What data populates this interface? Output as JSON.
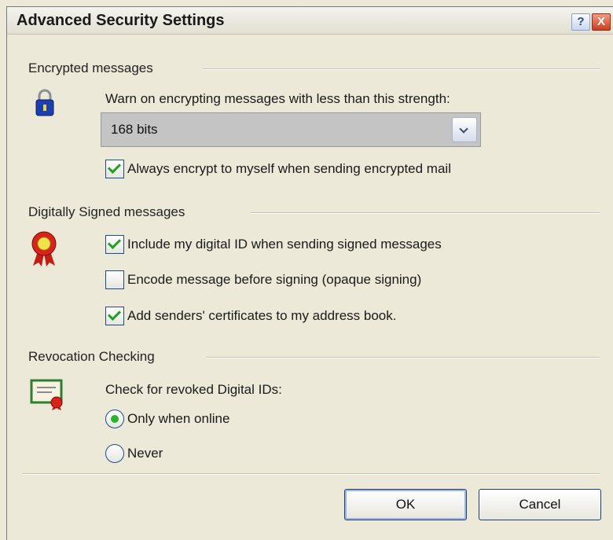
{
  "window": {
    "title": "Advanced Security Settings",
    "help_label": "?",
    "close_label": "X"
  },
  "encrypted": {
    "group_label": "Encrypted messages",
    "icon": "padlock-icon",
    "warn_label": "Warn on encrypting messages with less than this strength:",
    "strength_value": "168 bits",
    "always_encrypt_label": "Always encrypt to myself when sending encrypted mail",
    "always_encrypt_checked": true
  },
  "signed": {
    "group_label": "Digitally Signed messages",
    "icon": "award-ribbon-icon",
    "include_id_label": "Include my digital ID when sending signed messages",
    "include_id_checked": true,
    "encode_label": "Encode message before signing (opaque signing)",
    "encode_checked": false,
    "add_certs_label": "Add senders' certificates to my address book.",
    "add_certs_checked": true
  },
  "revocation": {
    "group_label": "Revocation Checking",
    "icon": "certificate-icon",
    "check_label": "Check for revoked Digital IDs:",
    "options": [
      {
        "label": "Only when online",
        "selected": true
      },
      {
        "label": "Never",
        "selected": false
      }
    ]
  },
  "buttons": {
    "ok": "OK",
    "cancel": "Cancel"
  },
  "colors": {
    "dialog_bg": "#ece9d8",
    "check_green": "#21a121",
    "border_blue": "#1f4a8a"
  }
}
